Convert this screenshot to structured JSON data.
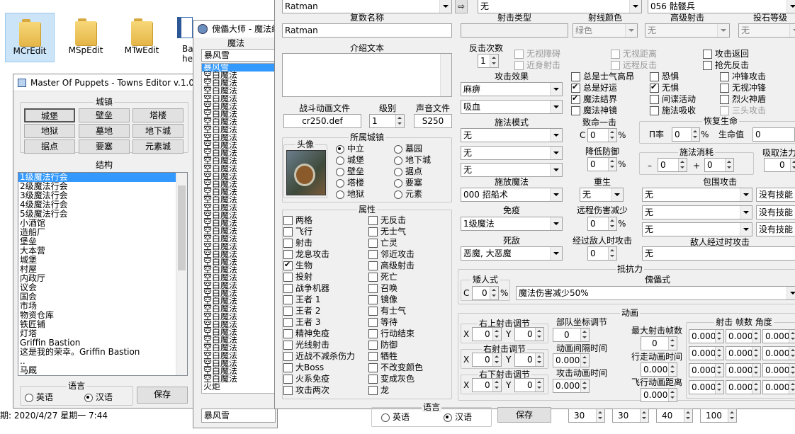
{
  "desktop": {
    "icons": [
      {
        "label": "MCrEdit"
      },
      {
        "label": "MSpEdit"
      },
      {
        "label": "MTwEdit"
      },
      {
        "label": "Ba\nhelp"
      }
    ],
    "clock": "期: 2020/4/27 星期一 7:44"
  },
  "towns": {
    "title": "Master Of Puppets - Towns Editor v.1.0",
    "town_group": "城镇",
    "town_buttons": [
      "城堡",
      "壁垒",
      "塔楼",
      "地狱",
      "墓地",
      "地下城",
      "据点",
      "要塞",
      "元素城"
    ],
    "structure_group": "结构",
    "structures": [
      "1级魔法行会",
      "2级魔法行会",
      "3级魔法行会",
      "4级魔法行会",
      "5级魔法行会",
      "小酒馆",
      "造船厂",
      "堡垒",
      "大本营",
      "城堡",
      "村屋",
      "内政厅",
      "议会",
      "国会",
      "市场",
      "物资仓库",
      "铁匠铺",
      "灯塔",
      "Griffin Bastion",
      "这是我的荣幸。Griffin Bastion",
      "..",
      "马厩"
    ],
    "language_group": "语言",
    "lang_en": "英语",
    "lang_cn": "汉语",
    "save": "保存"
  },
  "spells": {
    "title": "傀儡大师 - 魔法编",
    "list_header": "魔法",
    "selected_value": "暴风雪",
    "items": [
      "暴风雪",
      "空白魔法",
      "空白魔法",
      "空白魔法",
      "空白魔法",
      "空白魔法",
      "空白魔法",
      "空白魔法",
      "空白魔法",
      "空白魔法",
      "空白魔法",
      "空白魔法",
      "空白魔法",
      "空白魔法",
      "空白魔法",
      "空白魔法",
      "空白魔法",
      "空白魔法",
      "空白魔法",
      "空白魔法",
      "空白魔法",
      "空白魔法",
      "空白魔法",
      "空白魔法",
      "空白魔法",
      "空白魔法",
      "空白魔法",
      "空白魔法",
      "空白魔法",
      "空白魔法",
      "空白魔法",
      "空白魔法",
      "空白魔法",
      "空白魔法",
      "空白魔法",
      "空白魔法",
      "空白魔法",
      "空白魔法",
      "空白魔法",
      "空白魔法",
      "空白魔法",
      "火炬"
    ],
    "bottom_value": "暴风雪"
  },
  "creature": {
    "top_name": "Ratman",
    "top_dd2": "无",
    "top_dd3": "056 骷髅兵",
    "plural_label": "复数名称",
    "plural_value": "Ratman",
    "shoot_type_label": "射击类型",
    "ray_color_label": "射线颜色",
    "ray_color_value": "绿色",
    "adv_shoot_label": "高级射击",
    "adv_shoot_value": "无",
    "throw_label": "投石等级",
    "throw_value": "无",
    "intro_label": "介绍文本",
    "counter_label": "反击次数",
    "counter_value": "1",
    "cb_top": [
      {
        "label": "无视障碍",
        "dis": true,
        "on": false
      },
      {
        "label": "近身射击",
        "dis": true,
        "on": false
      },
      {
        "label": "无视距离",
        "dis": true,
        "on": false
      },
      {
        "label": "远程反击",
        "dis": true,
        "on": false
      },
      {
        "label": "攻击返回",
        "dis": false,
        "on": false
      },
      {
        "label": "抢先反击",
        "dis": false,
        "on": false
      }
    ],
    "attack_effect_label": "攻击效果",
    "attack_effect_1": "麻痹",
    "attack_effect_2": "吸血",
    "cb_morale": [
      {
        "label": "总是士气高昂",
        "on": false,
        "dis": false
      },
      {
        "label": "总是好运",
        "on": true,
        "dis": false
      },
      {
        "label": "魔法结界",
        "on": true,
        "dis": false
      },
      {
        "label": "魔法神镜",
        "on": false,
        "dis": false
      }
    ],
    "cb_fear": [
      {
        "label": "恐惧",
        "on": false,
        "dis": false
      },
      {
        "label": "无惧",
        "on": true,
        "dis": false
      },
      {
        "label": "间谍活动",
        "on": false,
        "dis": false
      },
      {
        "label": "施法吸收",
        "on": false,
        "dis": false
      }
    ],
    "cb_charge": [
      {
        "label": "冲锋攻击",
        "on": false,
        "dis": false
      },
      {
        "label": "无视冲锋",
        "on": false,
        "dis": false
      },
      {
        "label": "烈火神盾",
        "on": false,
        "dis": false
      },
      {
        "label": "三头攻击",
        "on": false,
        "dis": true
      }
    ],
    "anim_file_label": "战斗动画文件",
    "anim_file_value": "cr250.def",
    "level_label": "级别",
    "level_value": "1",
    "sound_label": "声音文件",
    "sound_value": "S250",
    "cast_mode_label": "施法模式",
    "cast_mode_values": [
      "无",
      "无",
      "无"
    ],
    "cast_spell_label": "施放魔法",
    "cast_spell_value": "000 招船术",
    "immune_label": "免疫",
    "immune_value": "1级魔法",
    "enemy_label": "死敌",
    "enemy_value": "恶魔, 大恶魔",
    "town_group": "所属城镇",
    "portrait_label": "头像",
    "towns_radio": [
      {
        "label": "中立",
        "on": true
      },
      {
        "label": "墓园",
        "on": false
      },
      {
        "label": "城堡",
        "on": false
      },
      {
        "label": "地下城",
        "on": false
      },
      {
        "label": "壁垒",
        "on": false
      },
      {
        "label": "据点",
        "on": false
      },
      {
        "label": "塔楼",
        "on": false
      },
      {
        "label": "要塞",
        "on": false
      },
      {
        "label": "地狱",
        "on": false
      },
      {
        "label": "元素",
        "on": false
      }
    ],
    "attr_group": "属性",
    "attrs_left": [
      {
        "label": "两格",
        "on": false
      },
      {
        "label": "飞行",
        "on": false
      },
      {
        "label": "射击",
        "on": false
      },
      {
        "label": "龙息攻击",
        "on": false
      },
      {
        "label": "生物",
        "on": true
      },
      {
        "label": "投射",
        "on": false
      },
      {
        "label": "战争机器",
        "on": false
      },
      {
        "label": "王者 1",
        "on": false
      },
      {
        "label": "王者 2",
        "on": false
      },
      {
        "label": "王者 3",
        "on": false
      },
      {
        "label": "精神免疫",
        "on": false
      },
      {
        "label": "光线射击",
        "on": false
      },
      {
        "label": "近战不减杀伤力",
        "on": false
      },
      {
        "label": "大Boss",
        "on": false
      },
      {
        "label": "火系免疫",
        "on": false
      },
      {
        "label": "攻击两次",
        "on": false
      }
    ],
    "attrs_right": [
      {
        "label": "无反击",
        "on": false
      },
      {
        "label": "无士气",
        "on": false
      },
      {
        "label": "亡灵",
        "on": false
      },
      {
        "label": "邻近攻击",
        "on": false
      },
      {
        "label": "高级射击",
        "on": false
      },
      {
        "label": "死亡",
        "on": false
      },
      {
        "label": "召唤",
        "on": false
      },
      {
        "label": "镜像",
        "on": false
      },
      {
        "label": "有士气",
        "on": false
      },
      {
        "label": "等待",
        "on": false
      },
      {
        "label": "行动结束",
        "on": false
      },
      {
        "label": "防御",
        "on": false
      },
      {
        "label": "牺牲",
        "on": false
      },
      {
        "label": "不改变颜色",
        "on": false
      },
      {
        "label": "变成灰色",
        "on": false
      },
      {
        "label": "龙",
        "on": false
      }
    ],
    "crit_label": "致命一击",
    "crit_prefix": "C",
    "crit_value": "0",
    "pct": "%",
    "reduce_def_label": "降低防御",
    "reduce_def_value": "0",
    "rebirth_label": "重生",
    "rebirth_value": "无",
    "ranged_reduce_label": "远程伤害减少",
    "ranged_reduce_value": "0",
    "pass_enemy_label": "经过敌人时攻击",
    "pass_enemy_value": "0",
    "regen_label": "恢复生命",
    "regen_rate_label": "П率",
    "regen_rate_value": "0",
    "regen_hp_label": "生命值",
    "regen_hp_value": "0",
    "cast_cost_label": "施法消耗",
    "cast_cost_minus": "–",
    "cast_cost_v1": "0",
    "cast_cost_plus": "+",
    "cast_cost_v2": "0",
    "absorb_label": "吸取法力",
    "absorb_value": "0",
    "surround_label": "包围攻击",
    "surround_values": [
      "无",
      "无",
      "无"
    ],
    "surround_side": [
      "没有技能",
      "没有技能",
      "没有技能"
    ],
    "enemy_pass_label": "敌人经过时攻击",
    "enemy_pass_value": "无",
    "resist_label": "抵抗力",
    "dwarf_label": "矮人式",
    "dwarf_prefix": "C",
    "dwarf_value": "0",
    "puppet_label": "傀儡式",
    "puppet_value": "魔法伤害减少50%",
    "anim_group": "动画",
    "upper_shoot_label": "右上射击调节",
    "mid_shoot_label": "右射击调节",
    "lower_shoot_label": "右下射击调节",
    "x_label": "X",
    "y_label": "Y",
    "shoot_xy": [
      [
        "0",
        "0"
      ],
      [
        "0",
        "0"
      ],
      [
        "0",
        "0"
      ]
    ],
    "troop_coord_label": "部队坐标调节",
    "troop_coord_value": "0",
    "anim_interval_label": "动画间隔时间",
    "anim_interval_value": "0.000",
    "attack_anim_label": "攻击动画时间",
    "attack_anim_value": "0.000",
    "max_frames_label": "最大射击帧数",
    "max_frames_value": "0",
    "walk_anim_label": "行走动画时间",
    "walk_anim_value": "0.000",
    "fly_dist_label": "飞行动画距离",
    "fly_dist_value": "0.000",
    "shoot_frames_label": "射击 帧数 角度",
    "frame_grid": [
      [
        "0.000",
        "0.000",
        "0.000"
      ],
      [
        "0.000",
        "0.000",
        "0.000"
      ],
      [
        "0.000",
        "0.000",
        "0.000"
      ],
      [
        "0.000",
        "0.000",
        "0.000"
      ]
    ],
    "lang_group": "语言",
    "lang_en": "英语",
    "lang_cn": "汉语",
    "save": "保存",
    "bottom_values": [
      "30",
      "30",
      "40",
      "100"
    ]
  },
  "colors": {
    "selection": "#3399ff",
    "window_bg": "#f0f0f0",
    "border": "#a0a0a0"
  }
}
